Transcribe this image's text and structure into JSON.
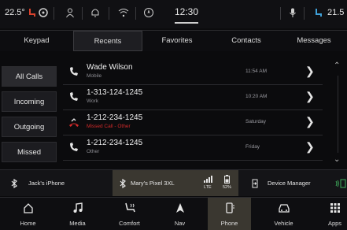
{
  "status": {
    "temperature": "22.5°",
    "time": "12:30",
    "right_temperature": "21.5"
  },
  "tabs": [
    "Keypad",
    "Recents",
    "Favorites",
    "Contacts",
    "Messages"
  ],
  "filters": [
    "All Calls",
    "Incoming",
    "Outgoing",
    "Missed"
  ],
  "calls": [
    {
      "name": "Wade Wilson",
      "sub": "Mobile",
      "time": "11:54 AM",
      "type": "incoming"
    },
    {
      "name": "1-313-124-1245",
      "sub": "Work",
      "time": "10:20 AM",
      "type": "incoming"
    },
    {
      "name": "1-212-234-1245",
      "sub": "Missed Call - Other",
      "time": "Saturday",
      "type": "missed"
    },
    {
      "name": "1-212-234-1245",
      "sub": "Other",
      "time": "Friday",
      "type": "incoming"
    }
  ],
  "devices": {
    "phone1": "Jack's iPhone",
    "phone2": "Mary's Pixel 3XL",
    "network": "LTE",
    "battery": "52%",
    "manager": "Device Manager"
  },
  "nav": [
    "Home",
    "Media",
    "Comfort",
    "Nav",
    "Phone",
    "Vehicle",
    "Apps"
  ],
  "colors": {
    "missed": "#d32a2a",
    "active_bg": "#3a3730"
  }
}
